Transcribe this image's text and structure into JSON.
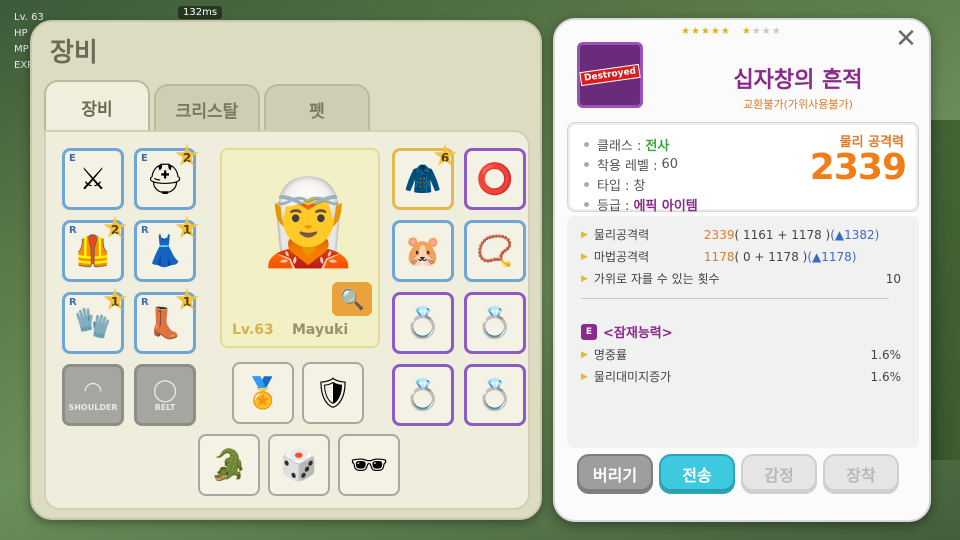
{
  "hud": {
    "level": "Lv. 63",
    "hp": "HP",
    "mp": "MP",
    "exp": "EXP",
    "ping": "132ms"
  },
  "equip": {
    "title": "장비",
    "tabs": [
      "장비",
      "크리스탈",
      "펫"
    ],
    "character": {
      "level": "Lv.63",
      "name": "Mayuki"
    },
    "slots": [
      {
        "grade": "E",
        "stars": "",
        "icon": "spear-icon",
        "glyph": "⚔"
      },
      {
        "grade": "E",
        "stars": "2",
        "icon": "helmet-icon",
        "glyph": "⛑"
      },
      {
        "grade": "R",
        "stars": "2",
        "icon": "armor-icon",
        "glyph": "🦺"
      },
      {
        "grade": "R",
        "stars": "1",
        "icon": "skirt-icon",
        "glyph": "👗"
      },
      {
        "grade": "R",
        "stars": "1",
        "icon": "gauntlet-icon",
        "glyph": "🧤"
      },
      {
        "grade": "R",
        "stars": "1",
        "icon": "boots-icon",
        "glyph": "👢"
      }
    ],
    "right_slots": [
      {
        "stars": "6",
        "icon": "cape-icon",
        "glyph": "🧥"
      },
      {
        "stars": "",
        "icon": "double-ring-icon",
        "glyph": "⭕"
      },
      {
        "stars": "",
        "icon": "pet-face-icon",
        "glyph": "🐹"
      },
      {
        "stars": "",
        "icon": "pendant-icon",
        "glyph": "📿"
      },
      {
        "stars": "",
        "icon": "ring-icon",
        "glyph": "💍"
      },
      {
        "stars": "",
        "icon": "ring-icon",
        "glyph": "💍"
      },
      {
        "stars": "",
        "icon": "ring-icon",
        "glyph": "💍"
      },
      {
        "stars": "",
        "icon": "ring-icon",
        "glyph": "💍"
      }
    ],
    "empty_slots": [
      "SHOULDER",
      "BELT"
    ],
    "bottom_slots": [
      {
        "icon": "medal-icon",
        "glyph": "🏅"
      },
      {
        "icon": "badge-icon",
        "glyph": "🛡"
      },
      {
        "icon": "crocodile-icon",
        "glyph": "🐊"
      },
      {
        "icon": "dice-card-icon",
        "glyph": "🎲"
      },
      {
        "icon": "sunglasses-icon",
        "glyph": "🕶"
      }
    ]
  },
  "tooltip": {
    "item_name": "십자창의 흔적",
    "sub": "교환불가(가위사용불가)",
    "badge": "Destroyed",
    "star_count_on": 5,
    "star_count_off": 4,
    "info": {
      "class_label": "클래스 :",
      "class_value": "전사",
      "level_label": "착용 레벨 :",
      "level_value": "60",
      "type_label": "타입 :",
      "type_value": "창",
      "grade_label": "등급 :",
      "grade_value": "에픽 아이템"
    },
    "phys_label": "물리 공격력",
    "phys_value": "2339",
    "stats": [
      {
        "label": "물리공격력",
        "main": "2339",
        "detail": "( 1161 + 1178 )",
        "bonus": "(▲1382)"
      },
      {
        "label": "마법공격력",
        "main": "1178",
        "detail": "( 0 + 1178 )",
        "bonus": "(▲1178)"
      },
      {
        "label": "가위로 자를 수 있는 횟수",
        "value": "10"
      }
    ],
    "potential_title": "<잠재능력>",
    "potential": [
      {
        "label": "명중률",
        "value": "1.6%"
      },
      {
        "label": "물리대미지증가",
        "value": "1.6%"
      }
    ],
    "buttons": [
      "버리기",
      "전송",
      "감정",
      "장착"
    ]
  }
}
